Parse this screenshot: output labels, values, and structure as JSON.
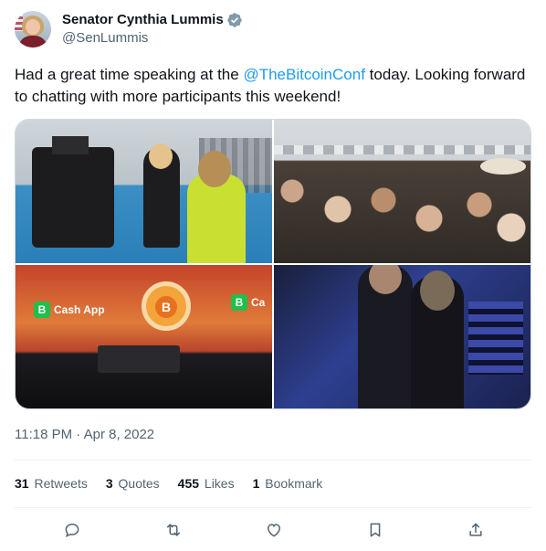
{
  "author": {
    "display_name": "Senator Cynthia Lummis",
    "handle": "@SenLummis",
    "verified_icon": "verified-badge-icon"
  },
  "tweet": {
    "text_before": "Had a great time speaking at the ",
    "mention": "@TheBitcoinConf",
    "text_after": " today. Looking forward to chatting with more participants this weekend!"
  },
  "media": {
    "cashapp_label": "Cash App",
    "cashapp_label_cut": "Ca",
    "cashapp_icon_letter": "B",
    "btc_symbol": "B"
  },
  "timestamp": "11:18 PM · Apr 8, 2022",
  "stats": {
    "retweets_count": "31",
    "retweets_label": "Retweets",
    "quotes_count": "3",
    "quotes_label": "Quotes",
    "likes_count": "455",
    "likes_label": "Likes",
    "bookmarks_count": "1",
    "bookmarks_label": "Bookmark"
  },
  "actions": [
    "reply-icon",
    "retweet-icon",
    "like-icon",
    "bookmark-icon",
    "share-icon"
  ],
  "colors": {
    "accent": "#1d9bf0",
    "text": "#0f1419",
    "muted": "#536471"
  }
}
